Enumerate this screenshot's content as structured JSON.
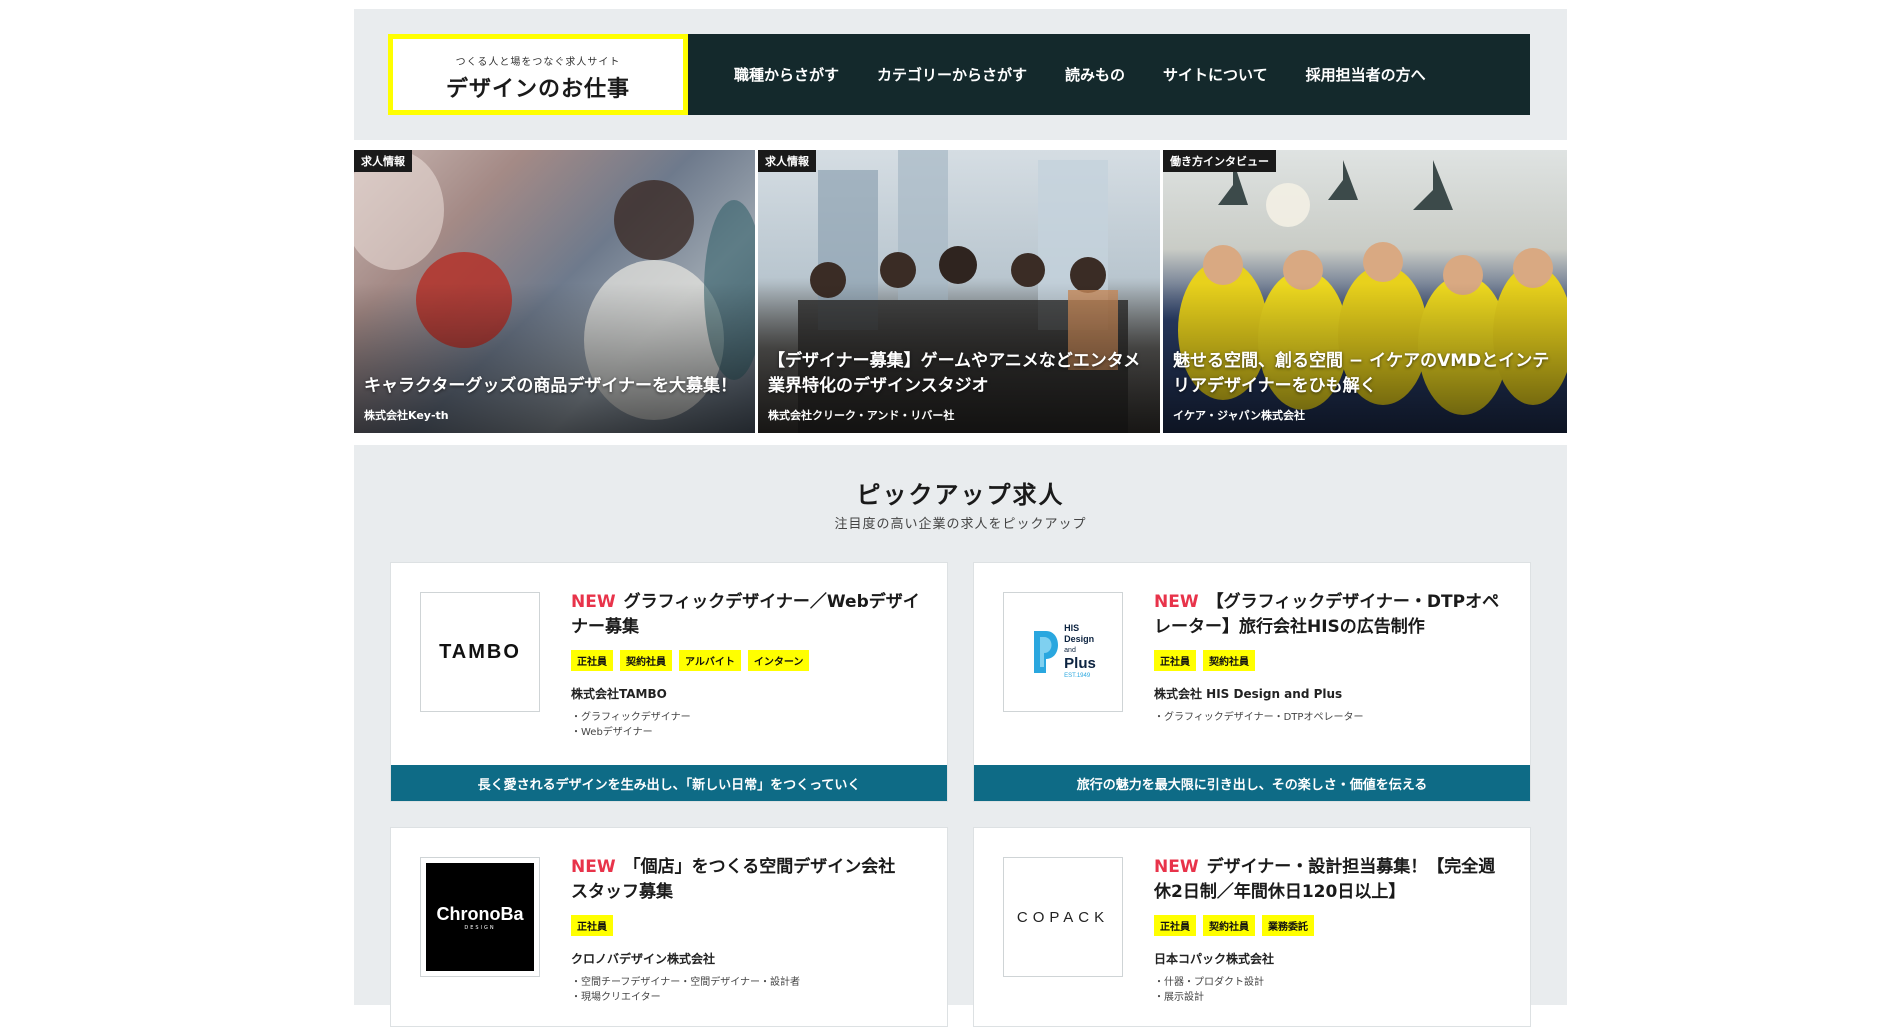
{
  "header": {
    "logo_sub": "つくる人と場をつなぐ求人サイト",
    "logo_main": "デザインのお仕事",
    "nav": [
      "職種からさがす",
      "カテゴリーからさがす",
      "読みもの",
      "サイトについて",
      "採用担当者の方へ"
    ]
  },
  "hero": [
    {
      "badge": "求人情報",
      "title": "キャラクターグッズの商品デザイナーを大募集！",
      "company": "株式会社Key-th"
    },
    {
      "badge": "求人情報",
      "title": "【デザイナー募集】ゲームやアニメなどエンタメ業界特化のデザインスタジオ",
      "company": "株式会社クリーク・アンド・リバー社"
    },
    {
      "badge": "働き方インタビュー",
      "title": "魅せる空間、創る空間 − イケアのVMDとインテリアデザイナーをひも解く",
      "company": "イケア・ジャパン株式会社"
    }
  ],
  "pickup": {
    "title": "ピックアップ求人",
    "subtitle": "注目度の高い企業の求人をピックアップ"
  },
  "jobs": [
    {
      "new": "NEW",
      "title": "グラフィックデザイナー／Webデザイナー募集",
      "tags": [
        "正社員",
        "契約社員",
        "アルバイト",
        "インターン"
      ],
      "company": "株式会社TAMBO",
      "roles": [
        "・グラフィックデザイナー",
        "・Webデザイナー"
      ],
      "band": "長く愛されるデザインを生み出し、「新しい日常」をつくっていく",
      "logo_text": "TAMBO"
    },
    {
      "new": "NEW",
      "title": "【グラフィックデザイナー・DTPオペレーター】旅行会社HISの広告制作",
      "tags": [
        "正社員",
        "契約社員"
      ],
      "company": "株式会社 HIS Design and Plus",
      "roles": [
        "・グラフィックデザイナー・DTPオペレーター"
      ],
      "band": "旅行の魅力を最大限に引き出し、その楽しさ・価値を伝える",
      "logo_text": [
        "HIS",
        "Design",
        "and",
        "Plus",
        "EST.1949"
      ]
    },
    {
      "new": "NEW",
      "title": "「個店」をつくる空間デザイン会社　スタッフ募集",
      "tags": [
        "正社員"
      ],
      "company": "クロノバデザイン株式会社",
      "roles": [
        "・空間チーフデザイナー・空間デザイナー・設計者",
        "・現場クリエイター"
      ],
      "band": "",
      "logo_text": [
        "ChronoBa",
        "DESIGN"
      ]
    },
    {
      "new": "NEW",
      "title": "デザイナー・設計担当募集！【完全週休2日制／年間休日120日以上】",
      "tags": [
        "正社員",
        "契約社員",
        "業務委託"
      ],
      "company": "日本コパック株式会社",
      "roles": [
        "・什器・プロダクト設計",
        "・展示設計"
      ],
      "band": "",
      "logo_text": "COPACK"
    }
  ]
}
